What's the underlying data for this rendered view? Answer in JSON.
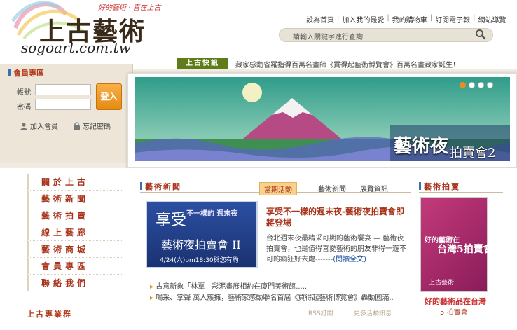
{
  "header": {
    "logo_title": "上古藝術",
    "logo_slogan": "好的藝術 · 喜在上古",
    "logo_url": "sogoart.com.tw",
    "nav": [
      "設為首頁",
      "加入我的最愛",
      "我的購物車",
      "訂閱電子報",
      "網站導覽"
    ],
    "search_placeholder": "請輸入關鍵字進行查詢"
  },
  "ticker": {
    "tag": "上古快訊",
    "text": "藏家感動省羅指得百萬名畫師《買得起藝術博覽會》百萬名畫藏家誕生！"
  },
  "member": {
    "title": "會員專區",
    "account_label": "帳號",
    "password_label": "密碼",
    "login_label": "登入",
    "join_label": "加入會員",
    "forgot_label": "忘記密碼"
  },
  "banner": {
    "caption": "藝術夜",
    "caption2": "拍賣會2",
    "slides": 4,
    "active_slide": 1
  },
  "leftnav": {
    "items": [
      "關於上古",
      "藝術新聞",
      "藝術拍賣",
      "線上藝廊",
      "藝術商城",
      "會員專區",
      "聯絡我們"
    ],
    "bottom_title": "上古專業群"
  },
  "news": {
    "title": "藝術新聞",
    "tabs": [
      "當期活動",
      "藝術新聞",
      "展覽資訊"
    ],
    "promo": {
      "t1": "享受",
      "t2": "不一樣的 週末夜",
      "t3": "藝術夜拍賣會 II",
      "t4": "4/24(六)pm18:30與您有約"
    },
    "article_head": "享受不一樣的週末夜-藝術夜拍賣會即將登場",
    "article_body": "台北週末夜最精采可期的藝術饗宴 — 藝術夜拍賣會，也是值得喜愛藝術的朋友非得一遊不可的瘋狂好去處-------",
    "article_more": "(閱讀全文)",
    "list": [
      "古意新象「林覃」彩泥畫展相約在廈門美術館.....",
      "喝采、掌聲 萬人簇擁，藝術家感動聯名首屆《買得起藝術博覽會》轟動圓滿.."
    ],
    "rss": "RSS訂閱",
    "more": "更多活動訊息"
  },
  "auction": {
    "title": "藝術拍賣",
    "poster_t1": "好的藝術在",
    "poster_t2": "台灣5拍賣會",
    "poster_logo": "上古藝術",
    "caption": "好的藝術品在台灣",
    "caption2": "5 拍賣會"
  },
  "colors": {
    "accent_red": "#a8321a",
    "ticker_green": "#5f7c18",
    "login_orange": "#e58a12"
  }
}
